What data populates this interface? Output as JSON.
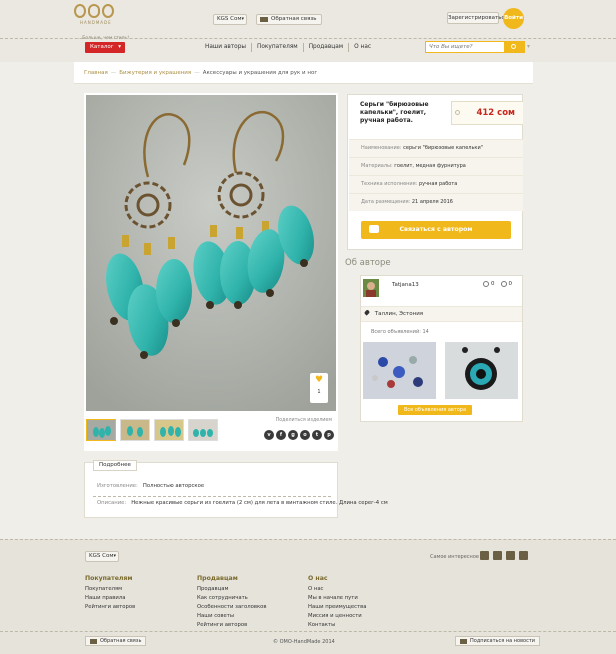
{
  "header": {
    "logo_alt": "OMO HANDMADE",
    "logo_sub": "HANDMADE",
    "slogan": "...Больше, чем стиль!",
    "currency": "KGS Сом",
    "feedback": "Обратная связь",
    "register": "Зарегистрироваться",
    "login": "Войти"
  },
  "nav": {
    "catalog": "Каталог",
    "items": [
      "Наши авторы",
      "Покупателям",
      "Продавцам",
      "О нас"
    ],
    "search_placeholder": "Что Вы ищете?"
  },
  "breadcrumb": {
    "items": [
      "Главная",
      "Бижутерия и украшения",
      "Аксессуары и украшения для рук и ног"
    ]
  },
  "product": {
    "title": "Серьги \"бирюзовые капельки\", гоелит, ручная работа.",
    "price": "412 сом",
    "likes": "1",
    "share_label": "Поделиться изделием",
    "socials": [
      "vk",
      "f",
      "g",
      "t",
      "tw",
      "p"
    ],
    "rows": [
      {
        "label": "Наименование:",
        "value": "серьги \"бирюзовые капельки\""
      },
      {
        "label": "Материалы:",
        "value": "гоелит, медная фурнитура"
      },
      {
        "label": "Техника исполнения:",
        "value": "ручная работа"
      },
      {
        "label": "Дата размещения:",
        "value": "21 апреля 2016"
      }
    ],
    "contact_button": "Связаться с автором"
  },
  "details": {
    "tab": "Подробнее",
    "rows": [
      {
        "label": "Изготовление:",
        "value": "Полностью авторское"
      },
      {
        "label": "Описание:",
        "value": "Нежные красивые серьги из гоелита (2 см) для лета в винтажном стиле. Длина серег-4 см"
      }
    ]
  },
  "author": {
    "heading": "Об авторе",
    "name": "Tatjana13",
    "positive": "0",
    "negative": "0",
    "location": "Таллин, Эстония",
    "ads_count": "Всего объявлений: 14",
    "all_ads": "Все объявления автора"
  },
  "footer": {
    "currency": "KGS Сом",
    "social_label": "Самое интересное на",
    "col1": {
      "title": "Покупателям",
      "links": [
        "Покупателям",
        "Наши правила",
        "Рейтинги авторов"
      ]
    },
    "col2": {
      "title": "Продавцам",
      "links": [
        "Продавцам",
        "Как сотрудничать",
        "Особенности заголовков",
        "Наши советы",
        "Рейтинги авторов"
      ]
    },
    "col3": {
      "title": "О нас",
      "links": [
        "О нас",
        "Мы в начале пути",
        "Наши преимущества",
        "Миссия и ценности",
        "Контакты"
      ]
    },
    "feedback": "Обратная связь",
    "copyright": "© OMO-HandMade 2014",
    "subscribe": "Подписаться на новости"
  },
  "colors": {
    "accent": "#f1b81b",
    "catalog": "#d42626",
    "price": "#c8261b",
    "gold_text": "#a98e43"
  }
}
